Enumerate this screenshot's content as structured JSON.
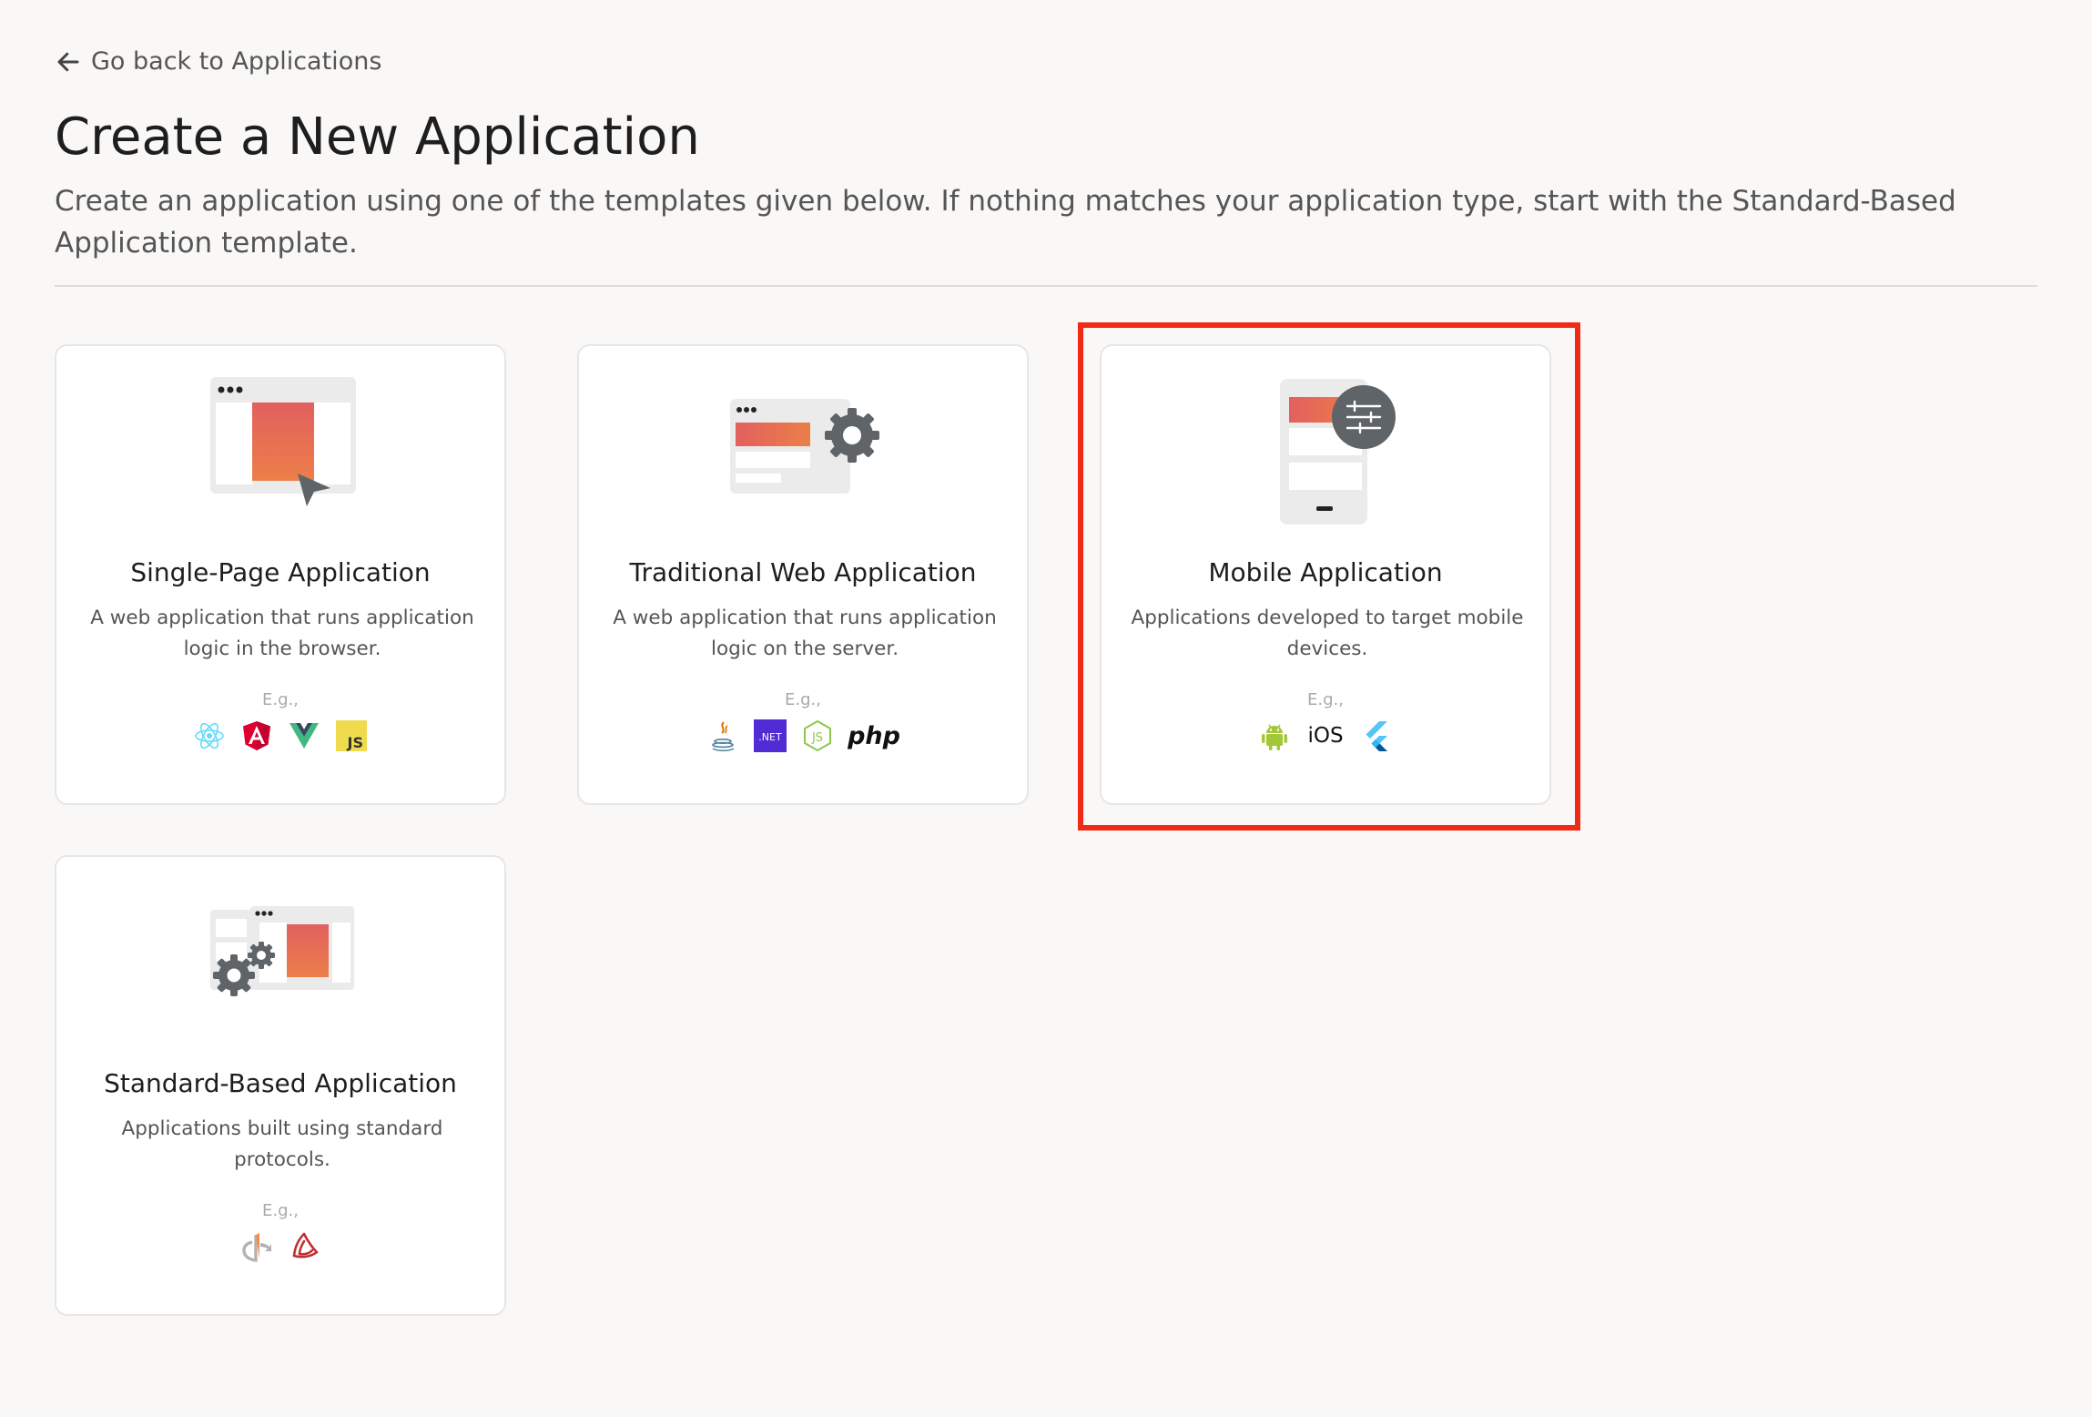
{
  "nav": {
    "back_label": "Go back to Applications"
  },
  "header": {
    "title": "Create a New Application",
    "description": "Create an application using one of the templates given below. If nothing matches your application type, start with the Standard-Based Application template."
  },
  "templates": [
    {
      "title": "Single-Page Application",
      "description": "A web application that runs application logic in the browser.",
      "eg_label": "E.g.,",
      "technologies": [
        "react-icon",
        "angular-icon",
        "vue-icon",
        "javascript-icon"
      ]
    },
    {
      "title": "Traditional Web Application",
      "description": "A web application that runs application logic on the server.",
      "eg_label": "E.g.,",
      "technologies": [
        "java-icon",
        "dotnet-icon",
        "nodejs-icon",
        "php-icon"
      ],
      "dotnet_text": ".NET",
      "php_text": "php"
    },
    {
      "title": "Mobile Application",
      "description": "Applications developed to target mobile devices.",
      "eg_label": "E.g.,",
      "technologies": [
        "android-icon",
        "ios-icon",
        "flutter-icon"
      ],
      "ios_text": "iOS",
      "highlighted": true
    },
    {
      "title": "Standard-Based Application",
      "description": "Applications built using standard protocols.",
      "eg_label": "E.g.,",
      "technologies": [
        "openid-icon",
        "saml-icon"
      ]
    }
  ],
  "colors": {
    "accent_gradient_top": "#e2605e",
    "accent_gradient_bottom": "#ec7f49",
    "highlight": "#f02a14",
    "icon_gray": "#5e6467"
  }
}
